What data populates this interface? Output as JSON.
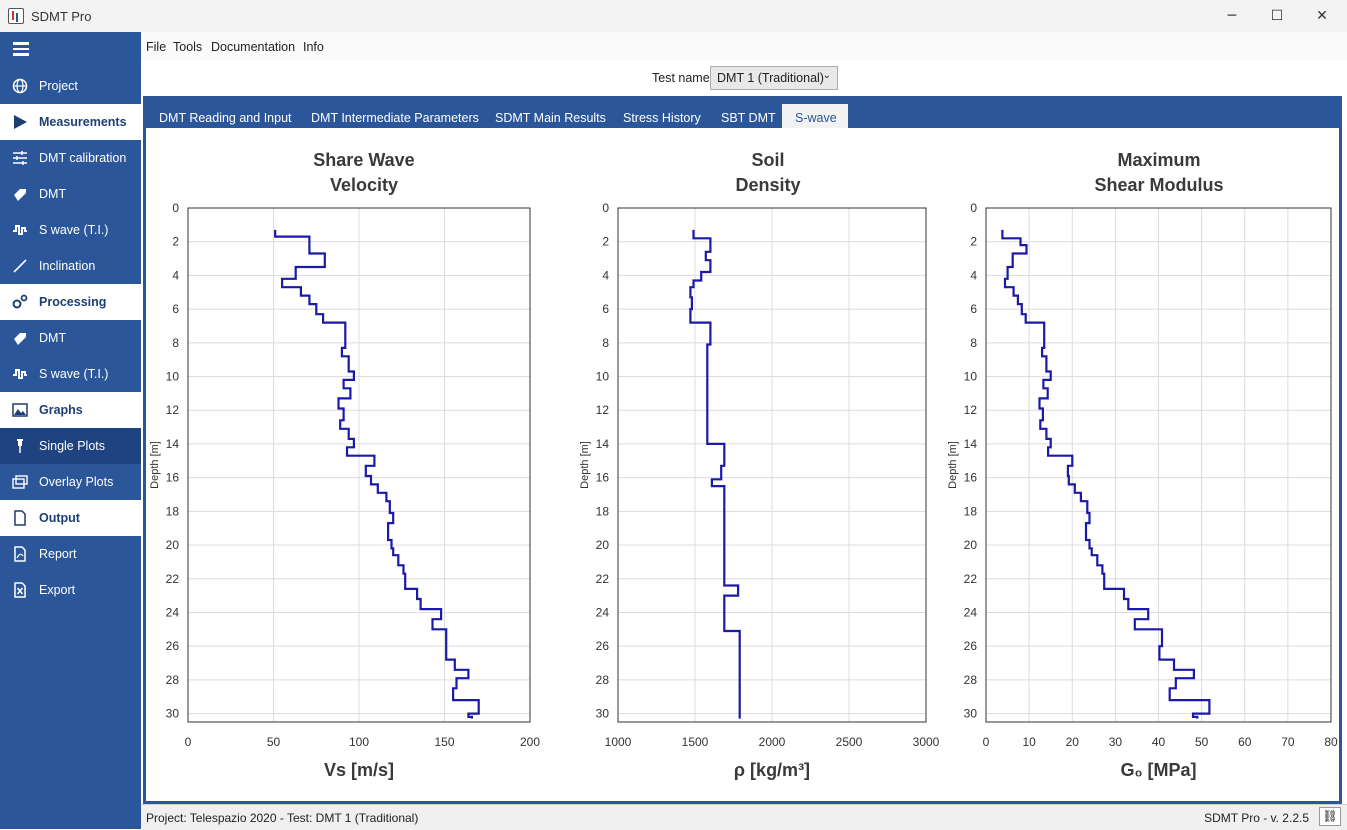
{
  "window": {
    "title": "SDMT Pro",
    "minimize_glyph": "─",
    "maximize_glyph": "☐",
    "close_glyph": "✕"
  },
  "menu": [
    "File",
    "Tools",
    "Documentation",
    "Info"
  ],
  "sidebar": {
    "items": [
      {
        "label": "Project",
        "icon": "globe-icon",
        "style": "normal"
      },
      {
        "label": "Measurements",
        "icon": "play-icon",
        "style": "white"
      },
      {
        "label": "DMT calibration",
        "icon": "sliders-icon",
        "style": "normal"
      },
      {
        "label": "DMT",
        "icon": "blade-icon",
        "style": "normal"
      },
      {
        "label": "S wave (T.I.)",
        "icon": "wave-icon",
        "style": "normal"
      },
      {
        "label": "Inclination",
        "icon": "slash-icon",
        "style": "normal"
      },
      {
        "label": "Processing",
        "icon": "gears-icon",
        "style": "white"
      },
      {
        "label": "DMT",
        "icon": "blade-icon",
        "style": "normal"
      },
      {
        "label": "S wave (T.I.)",
        "icon": "wave-icon",
        "style": "normal"
      },
      {
        "label": "Graphs",
        "icon": "image-icon",
        "style": "white"
      },
      {
        "label": "Single Plots",
        "icon": "pin-icon",
        "style": "dark"
      },
      {
        "label": "Overlay Plots",
        "icon": "layers-icon",
        "style": "normal"
      },
      {
        "label": "Output",
        "icon": "file-icon",
        "style": "white"
      },
      {
        "label": "Report",
        "icon": "pdf-icon",
        "style": "normal"
      },
      {
        "label": "Export",
        "icon": "excel-icon",
        "style": "normal"
      }
    ]
  },
  "test_selector": {
    "label": "Test name",
    "value": "DMT 1 (Traditional)"
  },
  "tabs": [
    {
      "label": "DMT Reading and Input",
      "active": false
    },
    {
      "label": "DMT Intermediate Parameters",
      "active": false
    },
    {
      "label": "SDMT Main Results",
      "active": false
    },
    {
      "label": "Stress History",
      "active": false
    },
    {
      "label": "SBT DMT",
      "active": false
    },
    {
      "label": "S-wave",
      "active": true
    }
  ],
  "status": {
    "left": "Project: Telespazio 2020 - Test: DMT 1 (Traditional)",
    "right": "SDMT Pro - v. 2.2.5",
    "link_icon": "⛓"
  },
  "colors": {
    "accent": "#2b579a",
    "series": "#1a1aa6"
  },
  "chart_data": [
    {
      "type": "line",
      "title": [
        "Share Wave",
        "Velocity"
      ],
      "xlabel": "Vs [m/s]",
      "ylabel": "Depth [m]",
      "xlim": [
        0,
        200
      ],
      "ylim": [
        0,
        30.5
      ],
      "y_inverted": true,
      "xticks": [
        0,
        50,
        100,
        150,
        200
      ],
      "yticks": [
        0,
        2,
        4,
        6,
        8,
        10,
        12,
        14,
        16,
        18,
        20,
        22,
        24,
        26,
        28,
        30
      ],
      "grid": true,
      "step_profile": [
        [
          1.3,
          1.7,
          51
        ],
        [
          1.7,
          2.7,
          71
        ],
        [
          2.7,
          3.5,
          80
        ],
        [
          3.5,
          4.2,
          63
        ],
        [
          4.2,
          4.7,
          55
        ],
        [
          4.7,
          5.2,
          66
        ],
        [
          5.2,
          5.7,
          71
        ],
        [
          5.7,
          6.3,
          75
        ],
        [
          6.3,
          6.8,
          79
        ],
        [
          6.8,
          8.3,
          92
        ],
        [
          8.3,
          8.8,
          90
        ],
        [
          8.8,
          9.7,
          94
        ],
        [
          9.7,
          10.2,
          97
        ],
        [
          10.2,
          10.7,
          91
        ],
        [
          10.7,
          11.3,
          95
        ],
        [
          11.3,
          11.9,
          88
        ],
        [
          11.9,
          12.6,
          91
        ],
        [
          12.6,
          13.1,
          89
        ],
        [
          13.1,
          13.7,
          94
        ],
        [
          13.7,
          14.2,
          97
        ],
        [
          14.2,
          14.7,
          93
        ],
        [
          14.7,
          15.3,
          109
        ],
        [
          15.3,
          15.9,
          104
        ],
        [
          15.9,
          16.4,
          107
        ],
        [
          16.4,
          16.9,
          111
        ],
        [
          16.9,
          17.4,
          116
        ],
        [
          17.4,
          18.1,
          118
        ],
        [
          18.1,
          18.7,
          120
        ],
        [
          18.7,
          19.7,
          117
        ],
        [
          19.7,
          20.2,
          119
        ],
        [
          20.2,
          20.6,
          120
        ],
        [
          20.6,
          21.2,
          123
        ],
        [
          21.2,
          21.7,
          126
        ],
        [
          21.7,
          22.6,
          127
        ],
        [
          22.6,
          23.2,
          134
        ],
        [
          23.2,
          23.8,
          136
        ],
        [
          23.8,
          24.4,
          148
        ],
        [
          24.4,
          25.0,
          143
        ],
        [
          25.0,
          26.0,
          151
        ],
        [
          26.0,
          26.8,
          151
        ],
        [
          26.8,
          27.4,
          156
        ],
        [
          27.4,
          27.9,
          164
        ],
        [
          27.9,
          28.5,
          157
        ],
        [
          28.5,
          29.2,
          155
        ],
        [
          29.2,
          30.0,
          170
        ],
        [
          30.0,
          30.2,
          164
        ],
        [
          30.2,
          30.3,
          166
        ]
      ]
    },
    {
      "type": "line",
      "title": [
        "Soil",
        "Density"
      ],
      "xlabel": "ρ [kg/m³]",
      "ylabel": "Depth [m]",
      "xlim": [
        1000,
        3000
      ],
      "ylim": [
        0,
        30.5
      ],
      "y_inverted": true,
      "xticks": [
        1000,
        1500,
        2000,
        2500,
        3000
      ],
      "yticks": [
        0,
        2,
        4,
        6,
        8,
        10,
        12,
        14,
        16,
        18,
        20,
        22,
        24,
        26,
        28,
        30
      ],
      "grid": true,
      "step_profile": [
        [
          1.3,
          1.8,
          1490
        ],
        [
          1.8,
          2.6,
          1600
        ],
        [
          2.6,
          3.1,
          1570
        ],
        [
          3.1,
          3.8,
          1600
        ],
        [
          3.8,
          4.3,
          1540
        ],
        [
          4.3,
          4.7,
          1490
        ],
        [
          4.7,
          5.3,
          1470
        ],
        [
          5.3,
          6.0,
          1480
        ],
        [
          6.0,
          6.8,
          1470
        ],
        [
          6.8,
          8.1,
          1600
        ],
        [
          8.1,
          14.0,
          1580
        ],
        [
          14.0,
          15.3,
          1690
        ],
        [
          15.3,
          16.1,
          1670
        ],
        [
          16.1,
          16.5,
          1610
        ],
        [
          16.5,
          22.4,
          1690
        ],
        [
          22.4,
          23.0,
          1780
        ],
        [
          23.0,
          25.1,
          1690
        ],
        [
          25.1,
          30.3,
          1790
        ]
      ]
    },
    {
      "type": "line",
      "title": [
        "Maximum",
        "Shear Modulus"
      ],
      "xlabel": "G₀ [MPa]",
      "ylabel": "Depth [m]",
      "xlim": [
        0,
        80
      ],
      "ylim": [
        0,
        30.5
      ],
      "y_inverted": true,
      "xticks": [
        0,
        10,
        20,
        30,
        40,
        50,
        60,
        70,
        80
      ],
      "yticks": [
        0,
        2,
        4,
        6,
        8,
        10,
        12,
        14,
        16,
        18,
        20,
        22,
        24,
        26,
        28,
        30
      ],
      "grid": true,
      "step_profile": [
        [
          1.3,
          1.8,
          3.8
        ],
        [
          1.8,
          2.2,
          8.0
        ],
        [
          2.2,
          2.7,
          9.4
        ],
        [
          2.7,
          3.5,
          6.2
        ],
        [
          3.5,
          4.2,
          5.0
        ],
        [
          4.2,
          4.7,
          4.4
        ],
        [
          4.7,
          5.2,
          6.4
        ],
        [
          5.2,
          5.7,
          7.4
        ],
        [
          5.7,
          6.3,
          8.3
        ],
        [
          6.3,
          6.8,
          9.2
        ],
        [
          6.8,
          8.3,
          13.5
        ],
        [
          8.3,
          8.8,
          13.0
        ],
        [
          8.8,
          9.7,
          14.0
        ],
        [
          9.7,
          10.2,
          15.0
        ],
        [
          10.2,
          10.7,
          13.3
        ],
        [
          10.7,
          11.3,
          14.3
        ],
        [
          11.3,
          11.9,
          12.4
        ],
        [
          11.9,
          12.6,
          13.2
        ],
        [
          12.6,
          13.1,
          12.6
        ],
        [
          13.1,
          13.7,
          14.0
        ],
        [
          13.7,
          14.2,
          15.0
        ],
        [
          14.2,
          14.7,
          14.4
        ],
        [
          14.7,
          15.3,
          20.0
        ],
        [
          15.3,
          15.9,
          19.0
        ],
        [
          15.9,
          16.4,
          19.2
        ],
        [
          16.4,
          16.9,
          20.6
        ],
        [
          16.9,
          17.4,
          22.0
        ],
        [
          17.4,
          18.1,
          23.5
        ],
        [
          18.1,
          18.7,
          24.0
        ],
        [
          18.7,
          19.7,
          23.2
        ],
        [
          19.7,
          20.2,
          24.0
        ],
        [
          20.2,
          20.6,
          24.5
        ],
        [
          20.6,
          21.2,
          25.8
        ],
        [
          21.2,
          21.7,
          27.0
        ],
        [
          21.7,
          22.6,
          27.4
        ],
        [
          22.6,
          23.2,
          32.0
        ],
        [
          23.2,
          23.8,
          33.0
        ],
        [
          23.8,
          24.4,
          37.6
        ],
        [
          24.4,
          25.0,
          34.5
        ],
        [
          25.0,
          26.0,
          40.8
        ],
        [
          26.0,
          26.8,
          40.2
        ],
        [
          26.8,
          27.4,
          43.6
        ],
        [
          27.4,
          27.9,
          48.2
        ],
        [
          27.9,
          28.5,
          44.0
        ],
        [
          28.5,
          29.2,
          42.6
        ],
        [
          29.2,
          30.0,
          51.8
        ],
        [
          30.0,
          30.2,
          48.0
        ],
        [
          30.2,
          30.3,
          49.0
        ]
      ]
    }
  ]
}
